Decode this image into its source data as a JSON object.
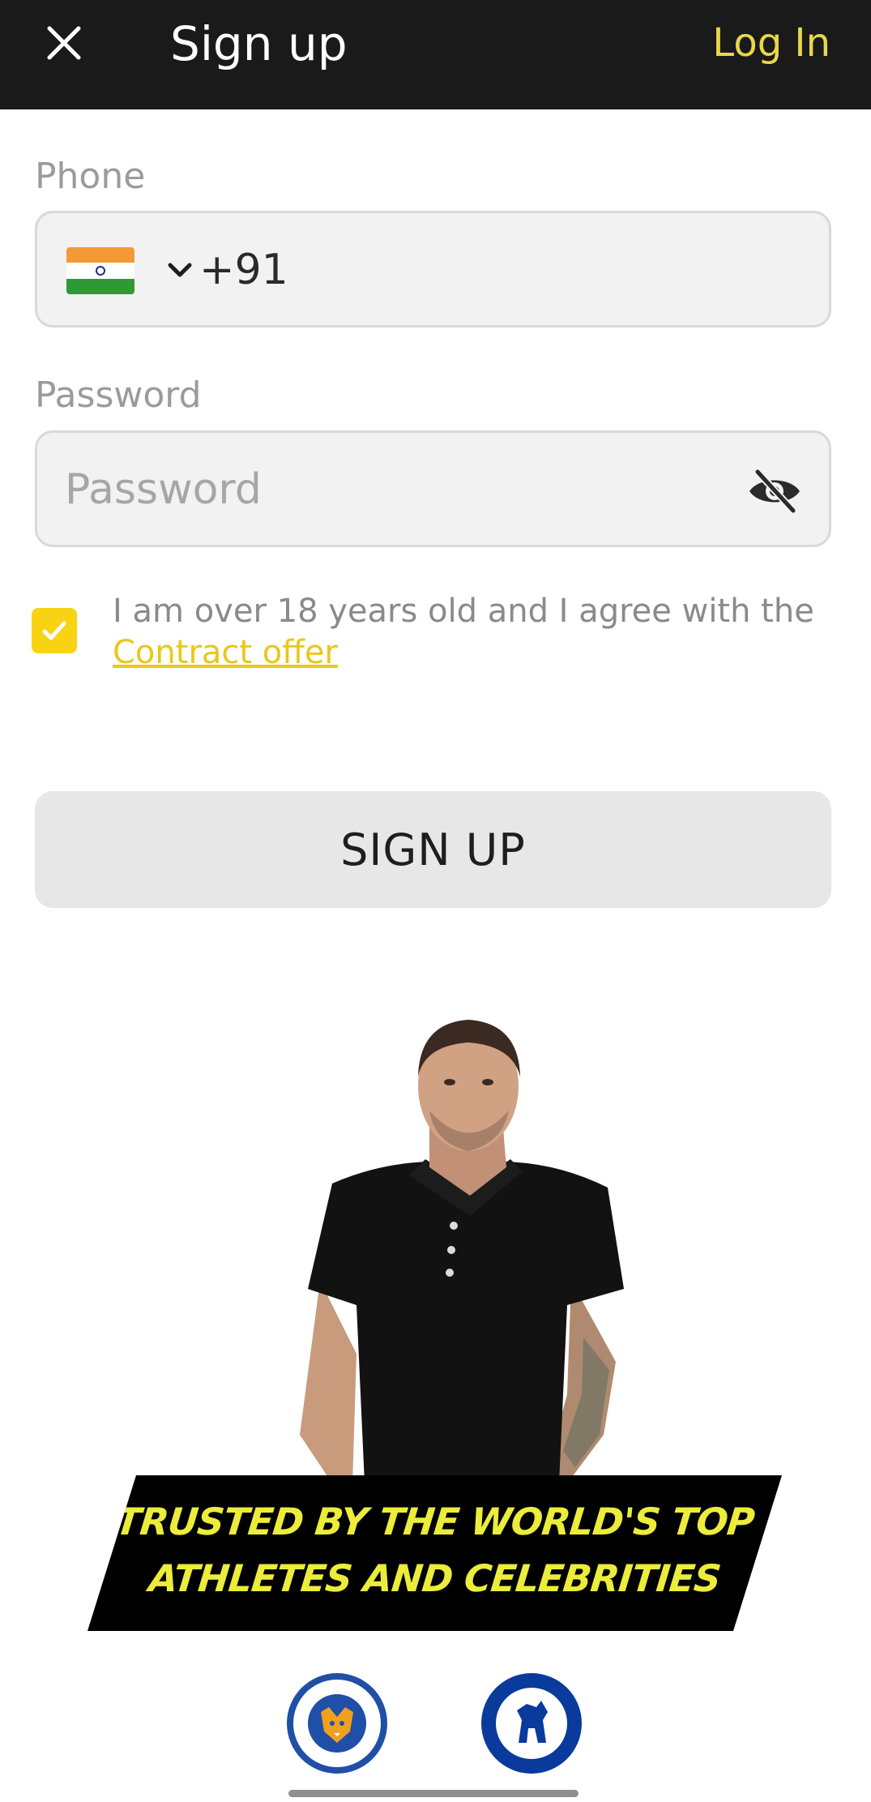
{
  "header": {
    "title": "Sign up",
    "login_label": "Log In",
    "close_icon": "close-icon",
    "background": "#1a1a1a",
    "accent": "#e8d84a"
  },
  "form": {
    "phone_label": "Phone",
    "country_flag": "india-flag-icon",
    "dial_code": "+91",
    "password_label": "Password",
    "password_placeholder": "Password",
    "password_visibility_icon": "eye-off-icon",
    "agreement_checked": true,
    "agreement_text": "I am over 18 years old and I agree with the",
    "contract_link": "Contract offer",
    "signup_label": "SIGN UP"
  },
  "promo": {
    "banner_line1": "TRUSTED BY THE WORLD'S TOP",
    "banner_line2": "ATHLETES AND CELEBRITIES",
    "banner_text_color": "#ecec3a",
    "partners": [
      {
        "name": "leicester-city-logo"
      },
      {
        "name": "chelsea-logo"
      }
    ]
  }
}
